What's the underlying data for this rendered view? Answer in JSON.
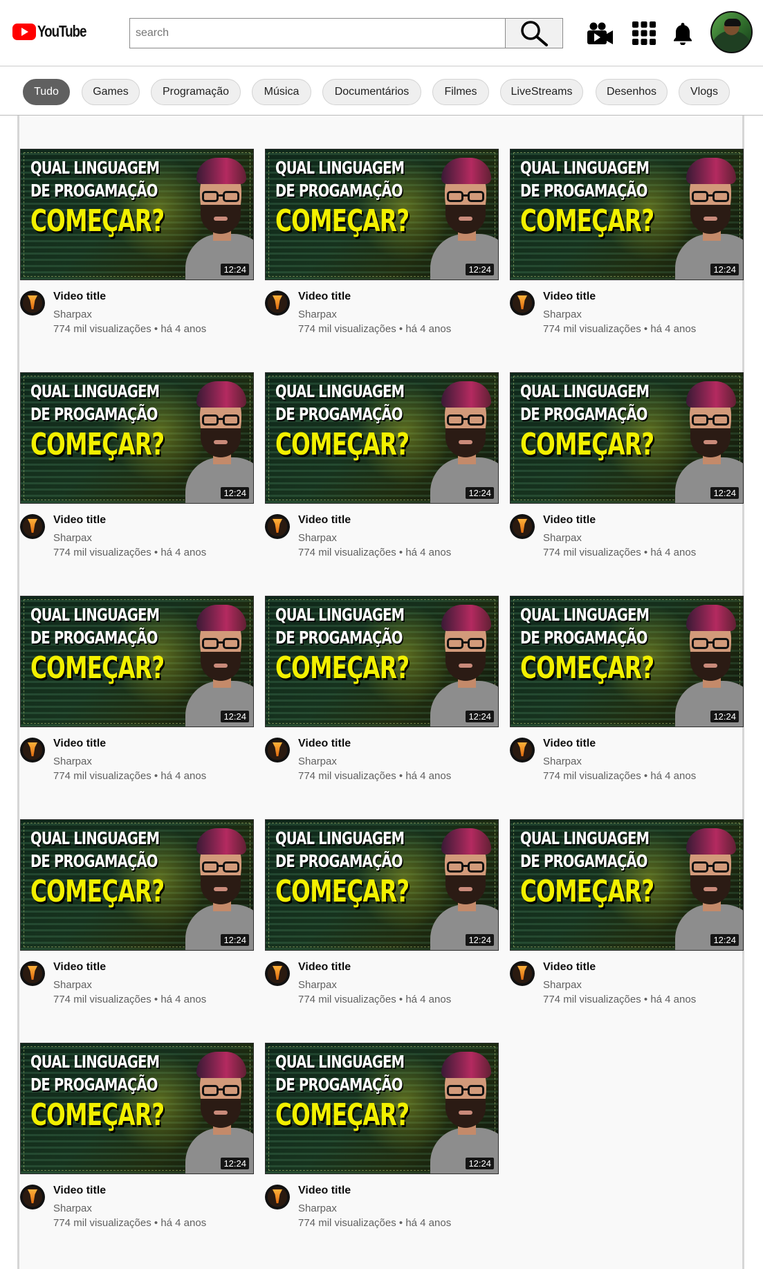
{
  "header": {
    "logo_text": "YouTube",
    "search_placeholder": "search",
    "search_value": ""
  },
  "icons": {
    "search": "search-icon",
    "upload": "video-camera-icon",
    "apps": "apps-grid-icon",
    "notifications": "bell-icon",
    "avatar": "user-avatar"
  },
  "chips": [
    {
      "label": "Tudo",
      "active": true
    },
    {
      "label": "Games",
      "active": false
    },
    {
      "label": "Programação",
      "active": false
    },
    {
      "label": "Música",
      "active": false
    },
    {
      "label": "Documentários",
      "active": false
    },
    {
      "label": "Filmes",
      "active": false
    },
    {
      "label": "LiveStreams",
      "active": false
    },
    {
      "label": "Desenhos",
      "active": false
    },
    {
      "label": "Vlogs",
      "active": false
    }
  ],
  "thumbnail_text": {
    "line1": "QUAL LINGUAGEM",
    "line2": "DE PROGAMAÇÃO",
    "line3": "COMEÇAR?"
  },
  "videos": [
    {
      "title": "Video title",
      "channel": "Sharpax",
      "meta": "774 mil visualizações • há 4 anos",
      "duration": "12:24"
    },
    {
      "title": "Video title",
      "channel": "Sharpax",
      "meta": "774 mil visualizações • há 4 anos",
      "duration": "12:24"
    },
    {
      "title": "Video title",
      "channel": "Sharpax",
      "meta": "774 mil visualizações • há 4 anos",
      "duration": "12:24"
    },
    {
      "title": "Video title",
      "channel": "Sharpax",
      "meta": "774 mil visualizações • há 4 anos",
      "duration": "12:24"
    },
    {
      "title": "Video title",
      "channel": "Sharpax",
      "meta": "774 mil visualizações • há 4 anos",
      "duration": "12:24"
    },
    {
      "title": "Video title",
      "channel": "Sharpax",
      "meta": "774 mil visualizações • há 4 anos",
      "duration": "12:24"
    },
    {
      "title": "Video title",
      "channel": "Sharpax",
      "meta": "774 mil visualizações • há 4 anos",
      "duration": "12:24"
    },
    {
      "title": "Video title",
      "channel": "Sharpax",
      "meta": "774 mil visualizações • há 4 anos",
      "duration": "12:24"
    },
    {
      "title": "Video title",
      "channel": "Sharpax",
      "meta": "774 mil visualizações • há 4 anos",
      "duration": "12:24"
    },
    {
      "title": "Video title",
      "channel": "Sharpax",
      "meta": "774 mil visualizações • há 4 anos",
      "duration": "12:24"
    },
    {
      "title": "Video title",
      "channel": "Sharpax",
      "meta": "774 mil visualizações • há 4 anos",
      "duration": "12:24"
    },
    {
      "title": "Video title",
      "channel": "Sharpax",
      "meta": "774 mil visualizações • há 4 anos",
      "duration": "12:24"
    },
    {
      "title": "Video title",
      "channel": "Sharpax",
      "meta": "774 mil visualizações • há 4 anos",
      "duration": "12:24"
    },
    {
      "title": "Video title",
      "channel": "Sharpax",
      "meta": "774 mil visualizações • há 4 anos",
      "duration": "12:24"
    }
  ]
}
